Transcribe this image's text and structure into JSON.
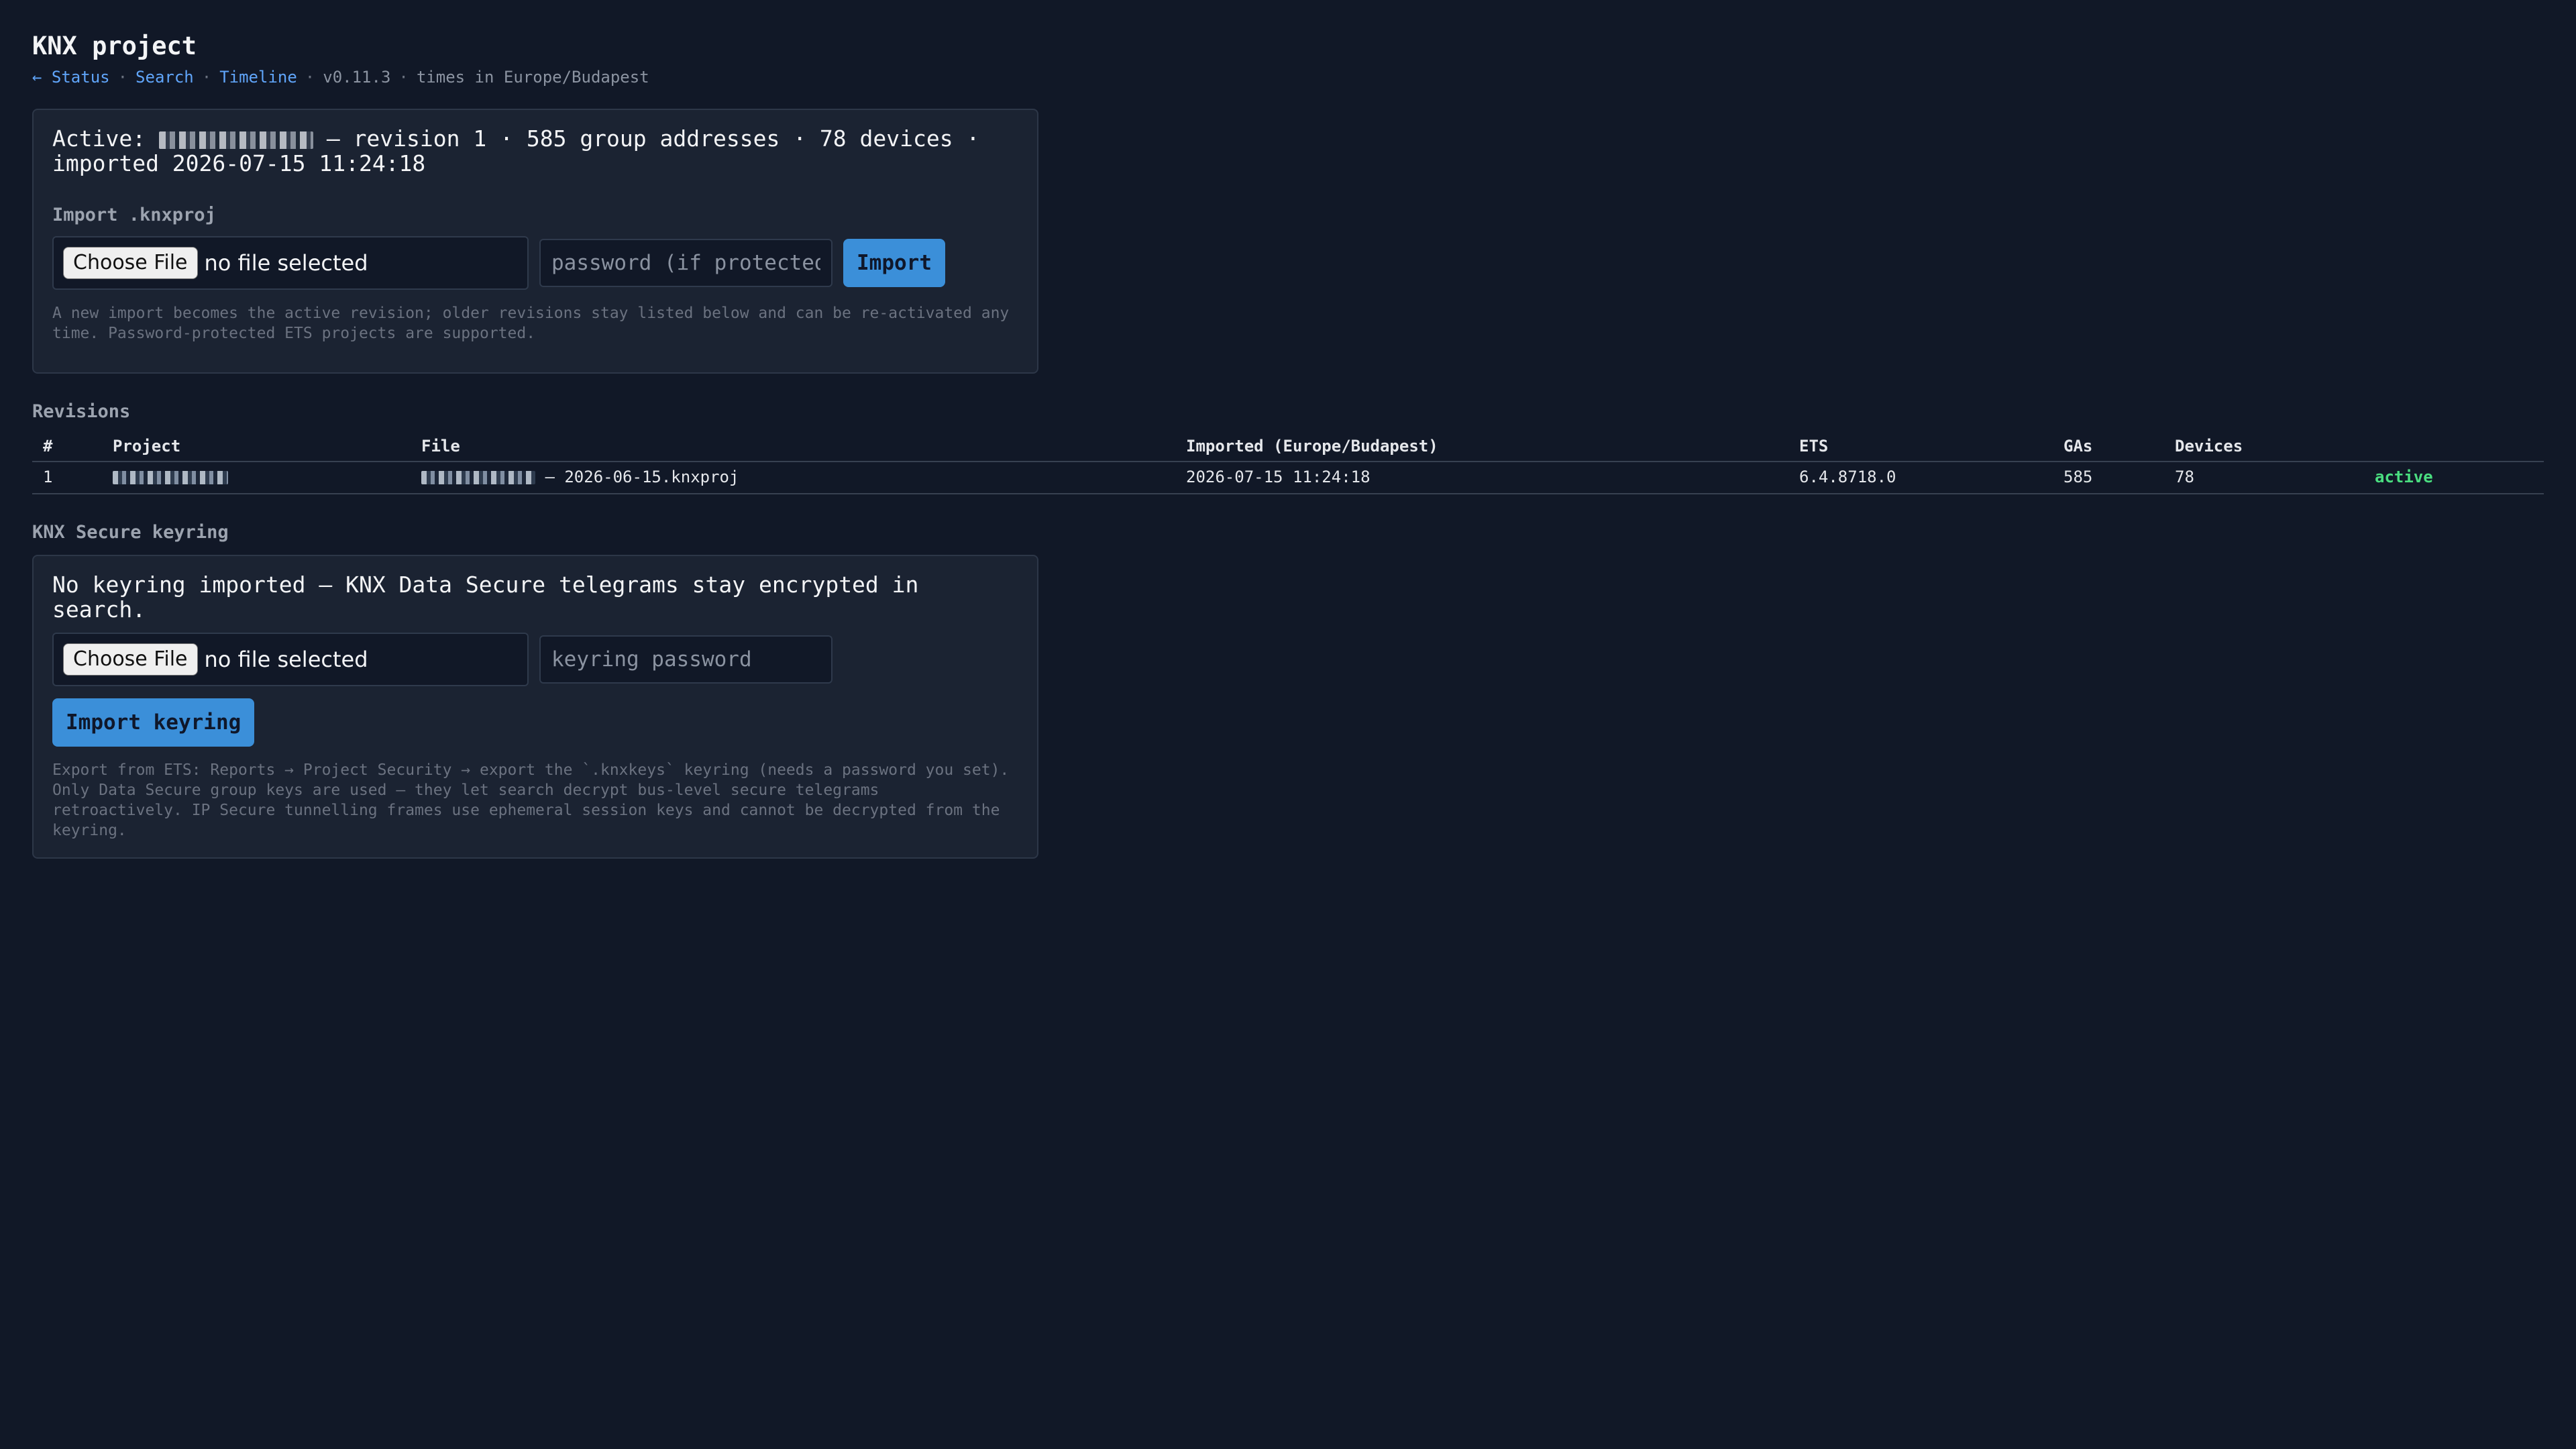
{
  "page": {
    "title": "KNX project"
  },
  "nav": {
    "status_link": "← Status",
    "search_link": "Search",
    "timeline_link": "Timeline",
    "separator": "·",
    "version": "v0.11.3",
    "timezone_note": "times in Europe/Budapest"
  },
  "project_card": {
    "active_prefix": "Active:",
    "active_suffix": "— revision 1 · 585 group addresses · 78 devices · imported 2026-07-15 11:24:18",
    "import_label": "Import .knxproj",
    "choose_file_label": "Choose File",
    "no_file_label": "no file selected",
    "password_placeholder": "password (if protected)",
    "import_button": "Import",
    "hint": "A new import becomes the active revision; older revisions stay listed below and can be re-activated any time. Password-protected ETS projects are supported."
  },
  "revisions": {
    "title": "Revisions",
    "columns": [
      "#",
      "Project",
      "File",
      "Imported (Europe/Budapest)",
      "ETS",
      "GAs",
      "Devices",
      ""
    ],
    "rows": [
      {
        "number": "1",
        "file_suffix": "– 2026-06-15.knxproj",
        "imported": "2026-07-15 11:24:18",
        "ets": "6.4.8718.0",
        "gas": "585",
        "devices": "78",
        "status": "active"
      }
    ]
  },
  "keyring": {
    "title": "KNX Secure keyring",
    "message": "No keyring imported — KNX Data Secure telegrams stay encrypted in search.",
    "choose_file_label": "Choose File",
    "no_file_label": "no file selected",
    "password_placeholder": "keyring password",
    "import_button": "Import keyring",
    "hint": "Export from ETS: Reports → Project Security → export the `.knxkeys` keyring (needs a password you set). Only Data Secure group keys are used — they let search decrypt bus-level secure telegrams retroactively. IP Secure tunnelling frames use ephemeral session keys and cannot be decrypted from the keyring."
  },
  "colors": {
    "background": "#111827",
    "card": "#1b2332",
    "accent": "#3b8fd9",
    "link": "#60a5fa",
    "active": "#4ade80"
  }
}
